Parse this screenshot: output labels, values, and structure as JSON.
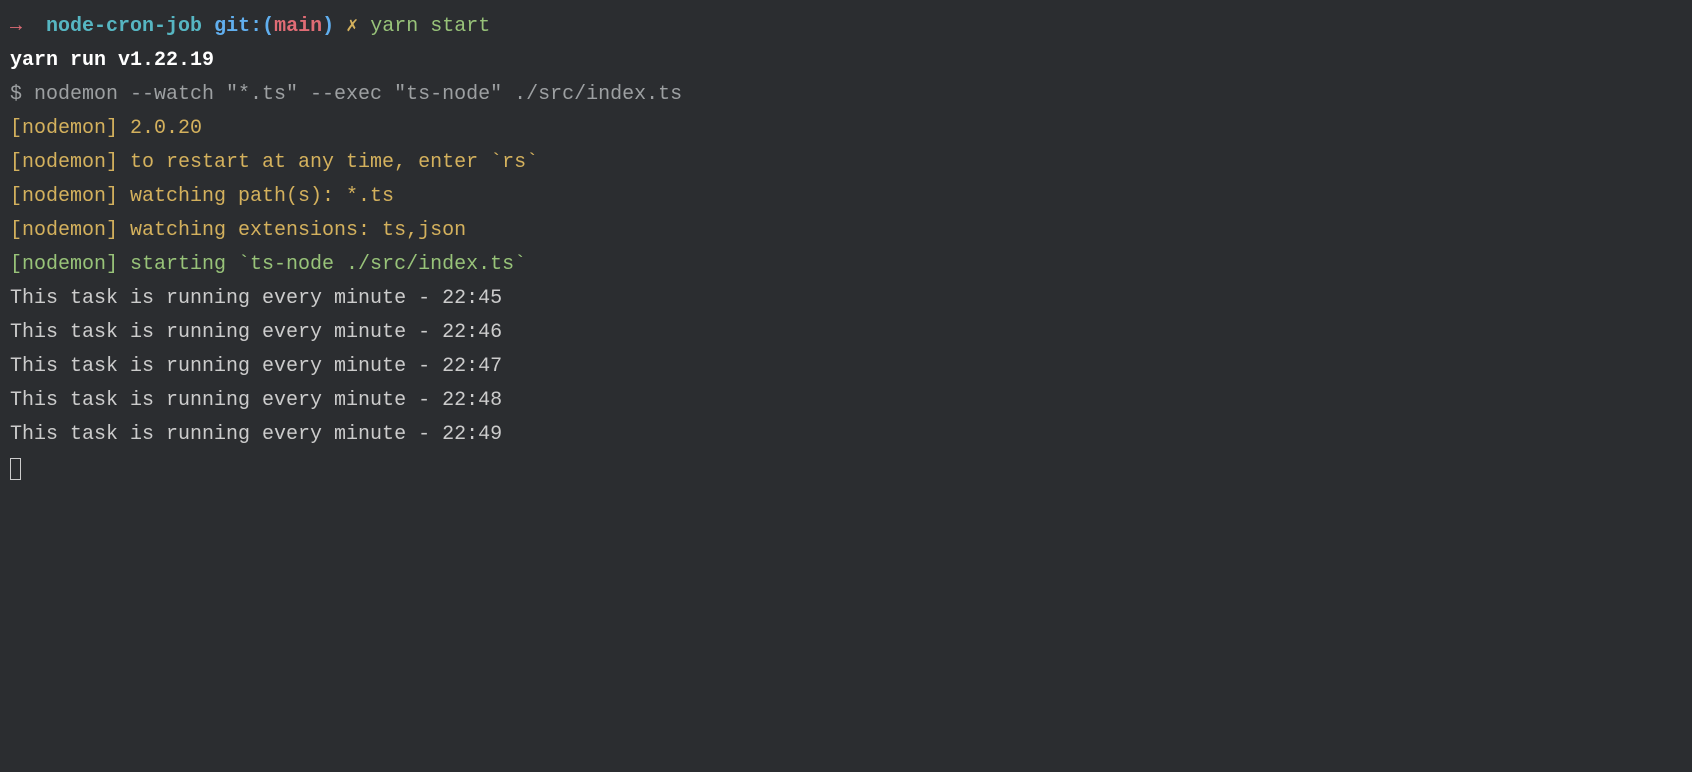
{
  "prompt": {
    "arrow": "→",
    "directory": "node-cron-job",
    "git_label": "git:",
    "paren_open": "(",
    "branch": "main",
    "paren_close": ")",
    "xmark": "✗",
    "command": "yarn start"
  },
  "output": {
    "yarn_version": "yarn run v1.22.19",
    "nodemon_cmd": "$ nodemon --watch \"*.ts\" --exec \"ts-node\" ./src/index.ts",
    "nodemon_version": "[nodemon] 2.0.20",
    "nodemon_restart": "[nodemon] to restart at any time, enter `rs`",
    "nodemon_paths": "[nodemon] watching path(s): *.ts",
    "nodemon_ext": "[nodemon] watching extensions: ts,json",
    "nodemon_starting": "[nodemon] starting `ts-node ./src/index.ts`",
    "task_lines": [
      "This task is running every minute - 22:45",
      "This task is running every minute - 22:46",
      "This task is running every minute - 22:47",
      "This task is running every minute - 22:48",
      "This task is running every minute - 22:49"
    ]
  }
}
